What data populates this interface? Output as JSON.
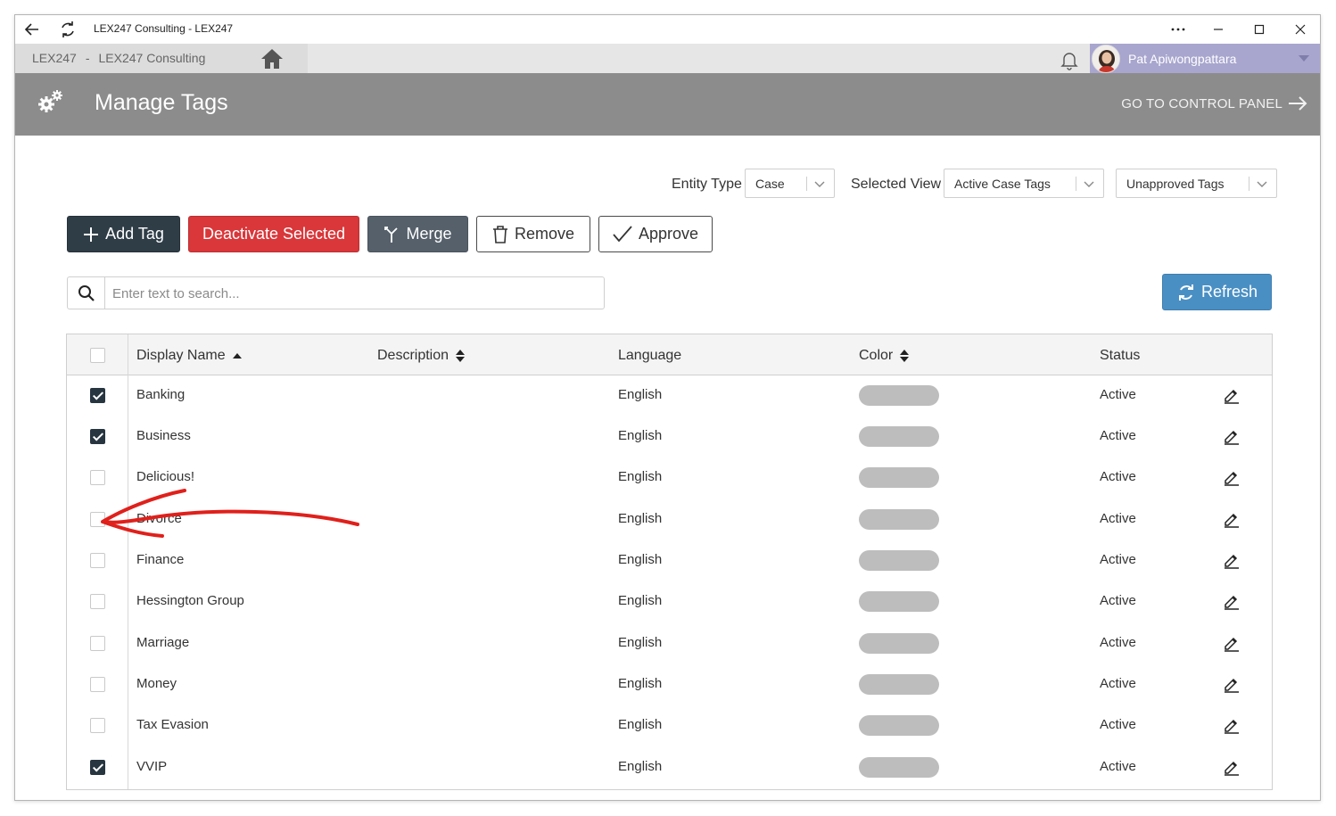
{
  "window": {
    "title": "LEX247 Consulting - LEX247"
  },
  "appbar": {
    "brand": "LEX247",
    "separator": "-",
    "org": "LEX247 Consulting",
    "user_name": "Pat Apiwongpattara"
  },
  "page": {
    "title": "Manage Tags",
    "control_panel_link": "GO TO CONTROL PANEL"
  },
  "filters": {
    "entity_type_label": "Entity Type",
    "entity_type_value": "Case",
    "selected_view_label": "Selected View",
    "selected_view_value": "Active Case Tags",
    "approval_value": "Unapproved Tags"
  },
  "actions": {
    "add": "Add Tag",
    "deactivate": "Deactivate Selected",
    "merge": "Merge",
    "remove": "Remove",
    "approve": "Approve",
    "refresh": "Refresh"
  },
  "search": {
    "placeholder": "Enter text to search..."
  },
  "table": {
    "headers": {
      "display_name": "Display Name",
      "description": "Description",
      "language": "Language",
      "color": "Color",
      "status": "Status"
    },
    "rows": [
      {
        "name": "Banking",
        "description": "",
        "language": "English",
        "status": "Active",
        "checked": true
      },
      {
        "name": "Business",
        "description": "",
        "language": "English",
        "status": "Active",
        "checked": true
      },
      {
        "name": "Delicious!",
        "description": "",
        "language": "English",
        "status": "Active",
        "checked": false
      },
      {
        "name": "Divorce",
        "description": "",
        "language": "English",
        "status": "Active",
        "checked": false
      },
      {
        "name": "Finance",
        "description": "",
        "language": "English",
        "status": "Active",
        "checked": false
      },
      {
        "name": "Hessington Group",
        "description": "",
        "language": "English",
        "status": "Active",
        "checked": false
      },
      {
        "name": "Marriage",
        "description": "",
        "language": "English",
        "status": "Active",
        "checked": false
      },
      {
        "name": "Money",
        "description": "",
        "language": "English",
        "status": "Active",
        "checked": false
      },
      {
        "name": "Tax Evasion",
        "description": "",
        "language": "English",
        "status": "Active",
        "checked": false
      },
      {
        "name": "VVIP",
        "description": "",
        "language": "English",
        "status": "Active",
        "checked": true
      }
    ]
  },
  "colors": {
    "header_band": "#8c8c8c",
    "user_band": "#a8a6ce",
    "btn_dark": "#2f3d47",
    "btn_red": "#d9373a",
    "btn_grey": "#55606b",
    "btn_refresh": "#4a8fc4",
    "swatch": "#bdbdbd",
    "annotation_arrow": "#e0201b"
  }
}
